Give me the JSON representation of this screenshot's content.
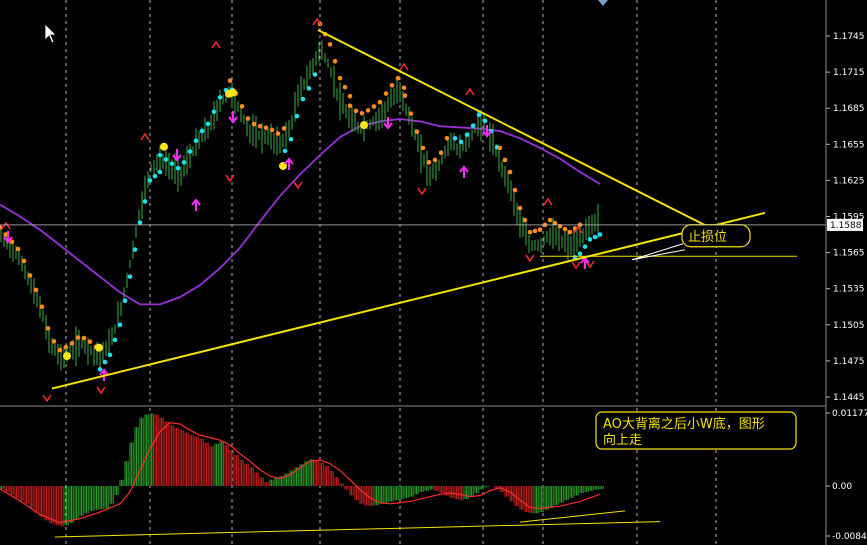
{
  "colors": {
    "background": "#000000",
    "grid": "#ffffff",
    "candles": "#3cb043",
    "ma_line": "#9b30d9",
    "stop_dots": "#ff8c1a",
    "rising_dots": "#1ee0f0",
    "signal_dots": "#ffe51a",
    "trendline": "#f5e400",
    "red_markers": "#ff2a2a",
    "magenta_arrows": "#ff2aff",
    "ao_green": "#2fa82f",
    "ao_red": "#d42020",
    "ao_signal": "#ff2a2a",
    "annotation": "#f5e400"
  },
  "chart_data": [
    {
      "type": "line",
      "panel": "price",
      "y_ticks": [
        "1.1745",
        "1.1715",
        "1.1685",
        "1.1655",
        "1.1625",
        "1.1595",
        "1.1565",
        "1.1535",
        "1.1505",
        "1.1475",
        "1.1445"
      ],
      "ylim": [
        1.1435,
        1.1762
      ],
      "current_price": "1.1588",
      "series": [
        {
          "style": "moving-average",
          "x": [
            0,
            20,
            40,
            60,
            80,
            100,
            120,
            140,
            160,
            180,
            200,
            220,
            240,
            260,
            280,
            300,
            320,
            340,
            360,
            380,
            400,
            420,
            440,
            460,
            480,
            500,
            520,
            540,
            560,
            580,
            600
          ],
          "y": [
            1.1605,
            1.1595,
            1.1584,
            1.1571,
            1.1558,
            1.1545,
            1.1532,
            1.1522,
            1.1522,
            1.1528,
            1.1538,
            1.1552,
            1.1569,
            1.1591,
            1.1612,
            1.163,
            1.1646,
            1.1661,
            1.167,
            1.1674,
            1.1676,
            1.1674,
            1.167,
            1.1669,
            1.1668,
            1.1666,
            1.166,
            1.1652,
            1.1643,
            1.1632,
            1.1622
          ]
        },
        {
          "style": "price",
          "x": [
            0,
            10,
            20,
            30,
            40,
            50,
            60,
            70,
            80,
            90,
            100,
            110,
            120,
            130,
            140,
            150,
            160,
            170,
            180,
            190,
            200,
            210,
            220,
            230,
            240,
            250,
            260,
            270,
            280,
            290,
            300,
            310,
            320,
            330,
            340,
            350,
            360,
            370,
            380,
            390,
            400,
            410,
            420,
            430,
            440,
            450,
            460,
            470,
            480,
            490,
            500,
            510,
            520,
            530,
            540,
            550,
            560,
            570,
            580,
            590,
            600
          ],
          "y": [
            1.158,
            1.157,
            1.156,
            1.154,
            1.152,
            1.149,
            1.1478,
            1.1482,
            1.149,
            1.1485,
            1.1478,
            1.149,
            1.1515,
            1.1555,
            1.16,
            1.1635,
            1.1642,
            1.1636,
            1.163,
            1.1645,
            1.166,
            1.167,
            1.169,
            1.17,
            1.1682,
            1.1665,
            1.1662,
            1.166,
            1.1655,
            1.1668,
            1.17,
            1.1715,
            1.1735,
            1.1718,
            1.169,
            1.1675,
            1.1668,
            1.1672,
            1.1678,
            1.169,
            1.17,
            1.1675,
            1.165,
            1.163,
            1.1638,
            1.1658,
            1.165,
            1.166,
            1.1675,
            1.1662,
            1.164,
            1.162,
            1.159,
            1.157,
            1.1572,
            1.158,
            1.1575,
            1.157,
            1.1576,
            1.1588,
            1.1592
          ]
        },
        {
          "style": "trendline-upper",
          "x": [
            318,
            726
          ],
          "y": [
            1.175,
            1.1579
          ]
        },
        {
          "style": "trendline-lower",
          "x": [
            52,
            765
          ],
          "y": [
            1.1452,
            1.1598
          ]
        },
        {
          "style": "stop-level",
          "x": [
            540,
            797
          ],
          "y": [
            1.1562,
            1.1562
          ]
        }
      ],
      "annotations": [
        {
          "text": "止损位",
          "x": 682,
          "y": 1.1579
        }
      ]
    },
    {
      "type": "bar",
      "panel": "ao",
      "y_ticks": [
        "0.01177",
        "0.00",
        "-0.00843"
      ],
      "ylim": [
        -0.009,
        0.0121
      ],
      "series": [
        {
          "style": "histogram",
          "x": [
            0,
            5,
            10,
            15,
            20,
            25,
            30,
            35,
            40,
            45,
            50,
            55,
            60,
            65,
            70,
            75,
            80,
            85,
            90,
            95,
            100,
            105,
            110,
            115,
            120,
            125,
            130,
            135,
            140,
            145,
            150,
            155,
            160,
            165,
            170,
            175,
            180,
            185,
            190,
            195,
            200,
            205,
            210,
            215,
            220,
            225,
            230,
            235,
            240,
            245,
            250,
            255,
            260,
            265,
            270,
            275,
            280,
            285,
            290,
            295,
            300,
            305,
            310,
            315,
            320,
            325,
            330,
            335,
            340,
            345,
            350,
            355,
            360,
            365,
            370,
            375,
            380,
            385,
            390,
            395,
            400,
            405,
            410,
            415,
            420,
            425,
            430,
            435,
            440,
            445,
            450,
            455,
            460,
            465,
            470,
            475,
            480,
            485,
            490,
            495,
            500,
            505,
            510,
            515,
            520,
            525,
            530,
            535,
            540,
            545,
            550,
            555,
            560,
            565,
            570,
            575,
            580,
            585,
            590,
            595,
            600
          ],
          "values": [
            -0.0005,
            -0.001,
            -0.0015,
            -0.002,
            -0.0025,
            -0.003,
            -0.0038,
            -0.0045,
            -0.0052,
            -0.0058,
            -0.0063,
            -0.0066,
            -0.0068,
            -0.0066,
            -0.0062,
            -0.0056,
            -0.005,
            -0.0046,
            -0.0042,
            -0.004,
            -0.0039,
            -0.0038,
            -0.003,
            -0.0015,
            0.001,
            0.004,
            0.007,
            0.0095,
            0.011,
            0.0115,
            0.0117,
            0.0115,
            0.011,
            0.0104,
            0.0098,
            0.0094,
            0.009,
            0.0086,
            0.0082,
            0.008,
            0.0076,
            0.007,
            0.0064,
            0.0068,
            0.0072,
            0.0066,
            0.0058,
            0.005,
            0.0042,
            0.0036,
            0.003,
            0.0022,
            0.0014,
            0.0006,
            0.001,
            0.0014,
            0.0016,
            0.002,
            0.0025,
            0.003,
            0.0035,
            0.004,
            0.0043,
            0.0042,
            0.0038,
            0.0032,
            0.0024,
            0.0014,
            0.0004,
            -0.0006,
            -0.0016,
            -0.0024,
            -0.003,
            -0.0033,
            -0.0034,
            -0.0032,
            -0.003,
            -0.0028,
            -0.0026,
            -0.0024,
            -0.0022,
            -0.002,
            -0.0018,
            -0.0014,
            -0.001,
            -0.0008,
            -0.0006,
            -0.0008,
            -0.0012,
            -0.0016,
            -0.002,
            -0.0022,
            -0.0024,
            -0.0022,
            -0.0018,
            -0.0012,
            -0.0006,
            -0.0002,
            0.0,
            -0.0004,
            -0.001,
            -0.0018,
            -0.0026,
            -0.0034,
            -0.004,
            -0.0044,
            -0.0046,
            -0.0046,
            -0.0044,
            -0.004,
            -0.0036,
            -0.0032,
            -0.0028,
            -0.0024,
            -0.002,
            -0.0016,
            -0.0012,
            -0.001,
            -0.0008,
            -0.0006,
            -0.0005
          ]
        },
        {
          "style": "signal-line",
          "x": [
            0,
            20,
            40,
            60,
            80,
            100,
            120,
            130,
            140,
            150,
            160,
            170,
            180,
            190,
            200,
            210,
            220,
            230,
            240,
            250,
            260,
            270,
            280,
            290,
            300,
            310,
            320,
            330,
            340,
            350,
            360,
            370,
            380,
            390,
            400,
            410,
            420,
            430,
            440,
            450,
            460,
            470,
            480,
            490,
            500,
            510,
            520,
            530,
            540,
            550,
            560,
            570,
            580,
            590,
            600
          ],
          "y": [
            -0.0005,
            -0.0025,
            -0.0048,
            -0.0062,
            -0.0055,
            -0.0044,
            -0.003,
            -0.001,
            0.0025,
            0.006,
            0.0088,
            0.0102,
            0.01,
            0.009,
            0.0082,
            0.0078,
            0.0074,
            0.0066,
            0.0052,
            0.004,
            0.0026,
            0.0016,
            0.0012,
            0.0018,
            0.003,
            0.004,
            0.0042,
            0.0036,
            0.0025,
            0.001,
            -0.0006,
            -0.002,
            -0.0028,
            -0.003,
            -0.0028,
            -0.0026,
            -0.0022,
            -0.0018,
            -0.0014,
            -0.0012,
            -0.0014,
            -0.0018,
            -0.0016,
            -0.0008,
            -0.0003,
            -0.001,
            -0.0024,
            -0.0036,
            -0.0038,
            -0.0036,
            -0.0034,
            -0.003,
            -0.0026,
            -0.002,
            -0.0014
          ]
        },
        {
          "style": "trendline",
          "x": [
            55,
            660
          ],
          "y": [
            -0.0086,
            -0.006
          ]
        },
        {
          "style": "trendline",
          "x": [
            520,
            625
          ],
          "y": [
            -0.0061,
            -0.0042
          ]
        }
      ],
      "annotations": [
        {
          "text": "AO大背离之后小W底，图形向上走"
        }
      ]
    }
  ]
}
